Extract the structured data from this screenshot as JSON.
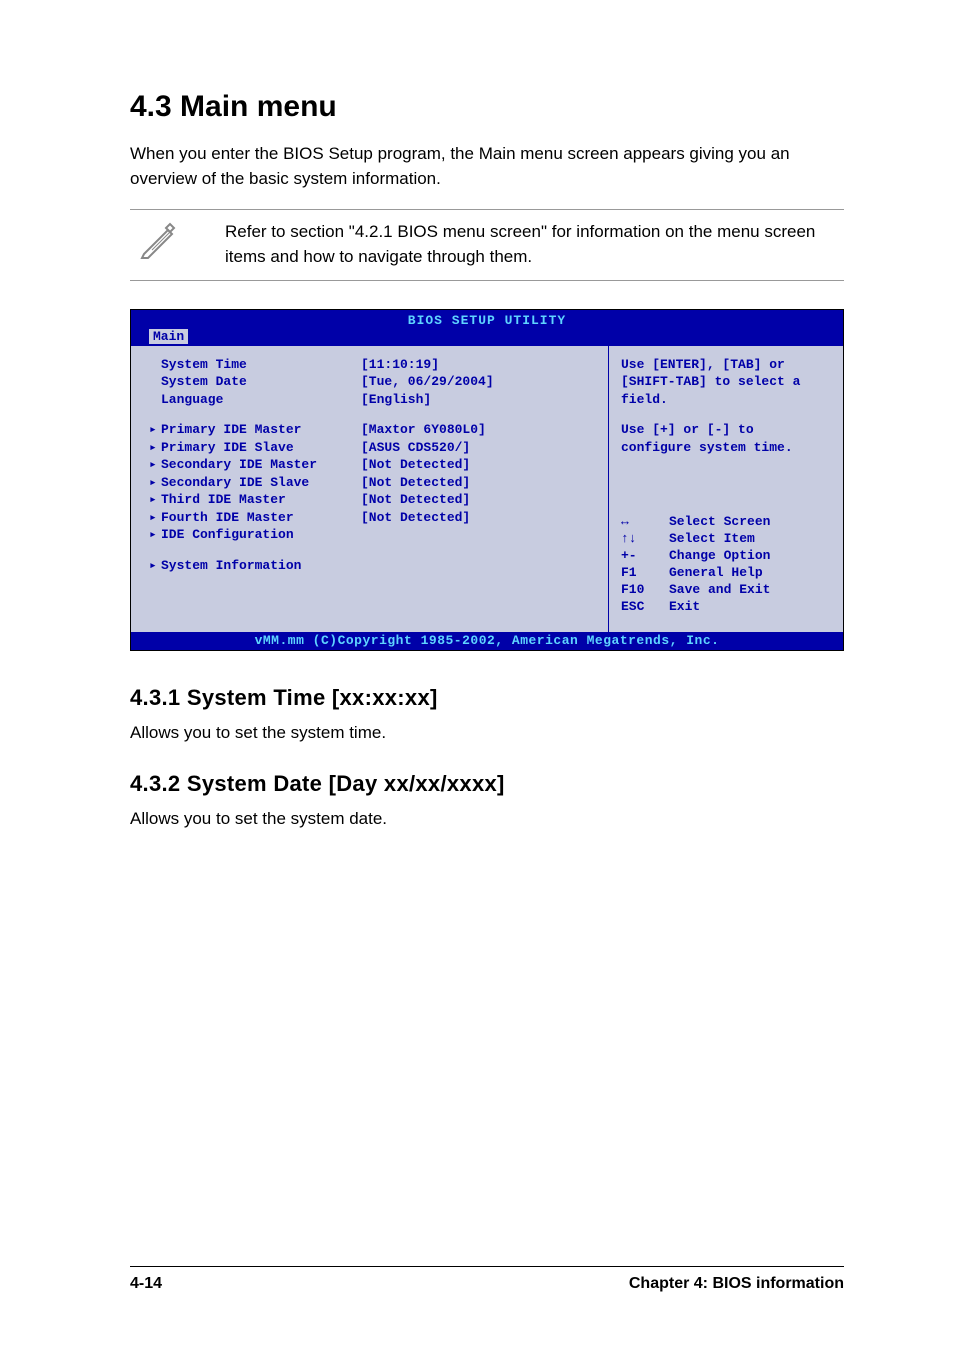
{
  "heading": "4.3    Main menu",
  "intro": "When you enter the BIOS Setup program, the Main menu screen appears giving you an overview of the basic system information.",
  "note": "Refer to section \"4.2.1 BIOS menu screen\" for information on the menu screen items and how to navigate through them.",
  "bios": {
    "title": "BIOS SETUP UTILITY",
    "tab": "Main",
    "rows_top": [
      {
        "label": "System Time",
        "value": "[11:10:19]",
        "arrow": false
      },
      {
        "label": "System Date",
        "value": "[Tue, 06/29/2004]",
        "arrow": false
      },
      {
        "label": "Language",
        "value": "[English]",
        "arrow": false
      }
    ],
    "rows_mid": [
      {
        "label": "Primary IDE Master",
        "value": "[Maxtor 6Y080L0]",
        "arrow": true
      },
      {
        "label": "Primary IDE Slave",
        "value": "[ASUS CDS520/]",
        "arrow": true
      },
      {
        "label": "Secondary IDE Master",
        "value": "[Not Detected]",
        "arrow": true
      },
      {
        "label": "Secondary IDE Slave",
        "value": "[Not Detected]",
        "arrow": true
      },
      {
        "label": "Third IDE Master",
        "value": "[Not Detected]",
        "arrow": true
      },
      {
        "label": "Fourth IDE Master",
        "value": "[Not Detected]",
        "arrow": true
      },
      {
        "label": "IDE Configuration",
        "value": "",
        "arrow": true
      }
    ],
    "rows_bot": [
      {
        "label": "System Information",
        "value": "",
        "arrow": true
      }
    ],
    "help1": "Use [ENTER], [TAB] or [SHIFT-TAB] to select a field.",
    "help2": "Use [+] or [-] to configure system time.",
    "keys": [
      {
        "k": "↔",
        "d": "Select Screen"
      },
      {
        "k": "↑↓",
        "d": "Select Item"
      },
      {
        "k": "+-",
        "d": "Change Option"
      },
      {
        "k": "F1",
        "d": "General Help"
      },
      {
        "k": "F10",
        "d": "Save and Exit"
      },
      {
        "k": "ESC",
        "d": "Exit"
      }
    ],
    "footer": "vMM.mm (C)Copyright 1985-2002, American Megatrends, Inc."
  },
  "sub1_h": "4.3.1   System Time [xx:xx:xx]",
  "sub1_p": "Allows you to set the system time.",
  "sub2_h": "4.3.2   System Date [Day xx/xx/xxxx]",
  "sub2_p": "Allows you to set the system date.",
  "footer_left": "4-14",
  "footer_right": "Chapter 4: BIOS information"
}
